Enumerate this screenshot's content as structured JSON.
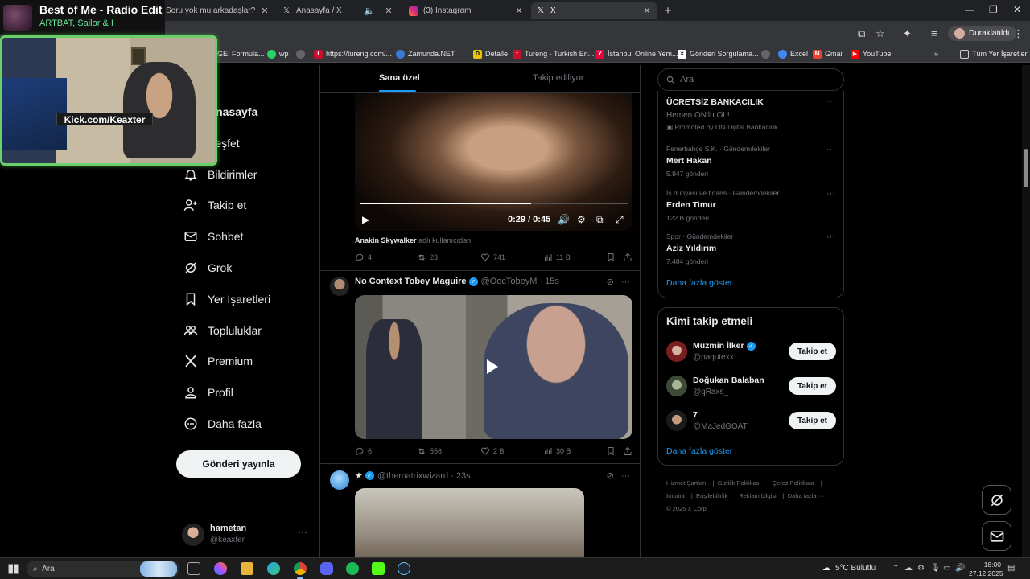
{
  "browser": {
    "tabs": [
      {
        "title": "Soru yok mu arkadaşlar? | Çağrı",
        "icon": "kick-icon"
      },
      {
        "title": "Anasayfa / X",
        "icon": "x-icon"
      },
      {
        "title": "(3) Instagram",
        "icon": "instagram-icon"
      },
      {
        "title": "X",
        "icon": "x-icon"
      }
    ],
    "paused_label": "Duraklatıldı",
    "bookmarks": [
      "GE: Formula...",
      "wp",
      "https://tureng.com/...",
      "Zamunda.NET",
      "Detalle",
      "Tureng - Turkish En...",
      "İstanbul Online Yem...",
      "Gönderi Sorgulama...",
      "Excel",
      "Gmail",
      "YouTube"
    ],
    "all_bookmarks": "Tüm Yer İşaretleri"
  },
  "overlay": {
    "song_title": "Best of Me - Radio Edit",
    "song_artist": "ARTBAT, Sailor & I",
    "channel": "Kick.com/Keaxter"
  },
  "nav": {
    "items": [
      "Anasayfa",
      "Keşfet",
      "Bildirimler",
      "Takip et",
      "Sohbet",
      "Grok",
      "Yer İşaretleri",
      "Topluluklar",
      "Premium",
      "Profil",
      "Daha fazla"
    ],
    "post_button": "Gönderi yayınla",
    "account": {
      "name": "hametan",
      "handle": "@keaxter"
    }
  },
  "feed": {
    "tabs": [
      "Sana özel",
      "Takip ediliyor"
    ],
    "post1": {
      "time": "0:29 / 0:45",
      "progress": 0.64,
      "source_name": "Anakin Skywalker",
      "source_suffix": "adlı kullanıcıdan",
      "replies": "4",
      "reposts": "23",
      "likes": "741",
      "views": "11 B"
    },
    "post2": {
      "name": "No Context Tobey Maguire",
      "handle": "@OocTobeyM · 15s",
      "replies": "6",
      "reposts": "556",
      "likes": "2 B",
      "views": "30 B"
    },
    "post3": {
      "name": "★",
      "handle": "@thematrixwizard · 23s"
    }
  },
  "right": {
    "search_placeholder": "Ara",
    "promo": {
      "title": "ÜCRETSİZ BANKACILIK",
      "subtitle": "Hemen ON'lu OL!",
      "promoted": "Promoted by ON Dijital Bankacılık"
    },
    "trends": [
      {
        "context": "Fenerbahçe S.K. · Gündemdekiler",
        "title": "Mert Hakan",
        "count": "5.947 gönderi"
      },
      {
        "context": "İş dünyası ve finans · Gündemdekiler",
        "title": "Erden Timur",
        "count": "122 B gönderi"
      },
      {
        "context": "Spor · Gündemdekiler",
        "title": "Aziz Yıldırım",
        "count": "7.484 gönderi"
      }
    ],
    "show_more": "Daha fazla göster",
    "who_to_follow_title": "Kimi takip etmeli",
    "who_to_follow": [
      {
        "name": "Müzmin İlker",
        "handle": "@paqutexx",
        "verified": true
      },
      {
        "name": "Doğukan Balaban",
        "handle": "@qRaxs_",
        "verified": false
      },
      {
        "name": "7",
        "handle": "@MaJedGOAT",
        "verified": false
      }
    ],
    "follow_label": "Takip et",
    "footer": [
      "Hizmet Şartları",
      "Gizlilik Politikası",
      "Çerez Politikası",
      "Imprint",
      "Erişilebilirlik",
      "Reklam bilgisi",
      "Daha fazla ···",
      "© 2025 X Corp."
    ]
  },
  "taskbar": {
    "search": "Ara",
    "weather": "5°C  Bulutlu",
    "time": "18:00",
    "date": "27.12.2025"
  },
  "colors": {
    "accent": "#1d9bf0",
    "overlay_border": "#6bd06b",
    "artist_green": "#67e39a"
  }
}
